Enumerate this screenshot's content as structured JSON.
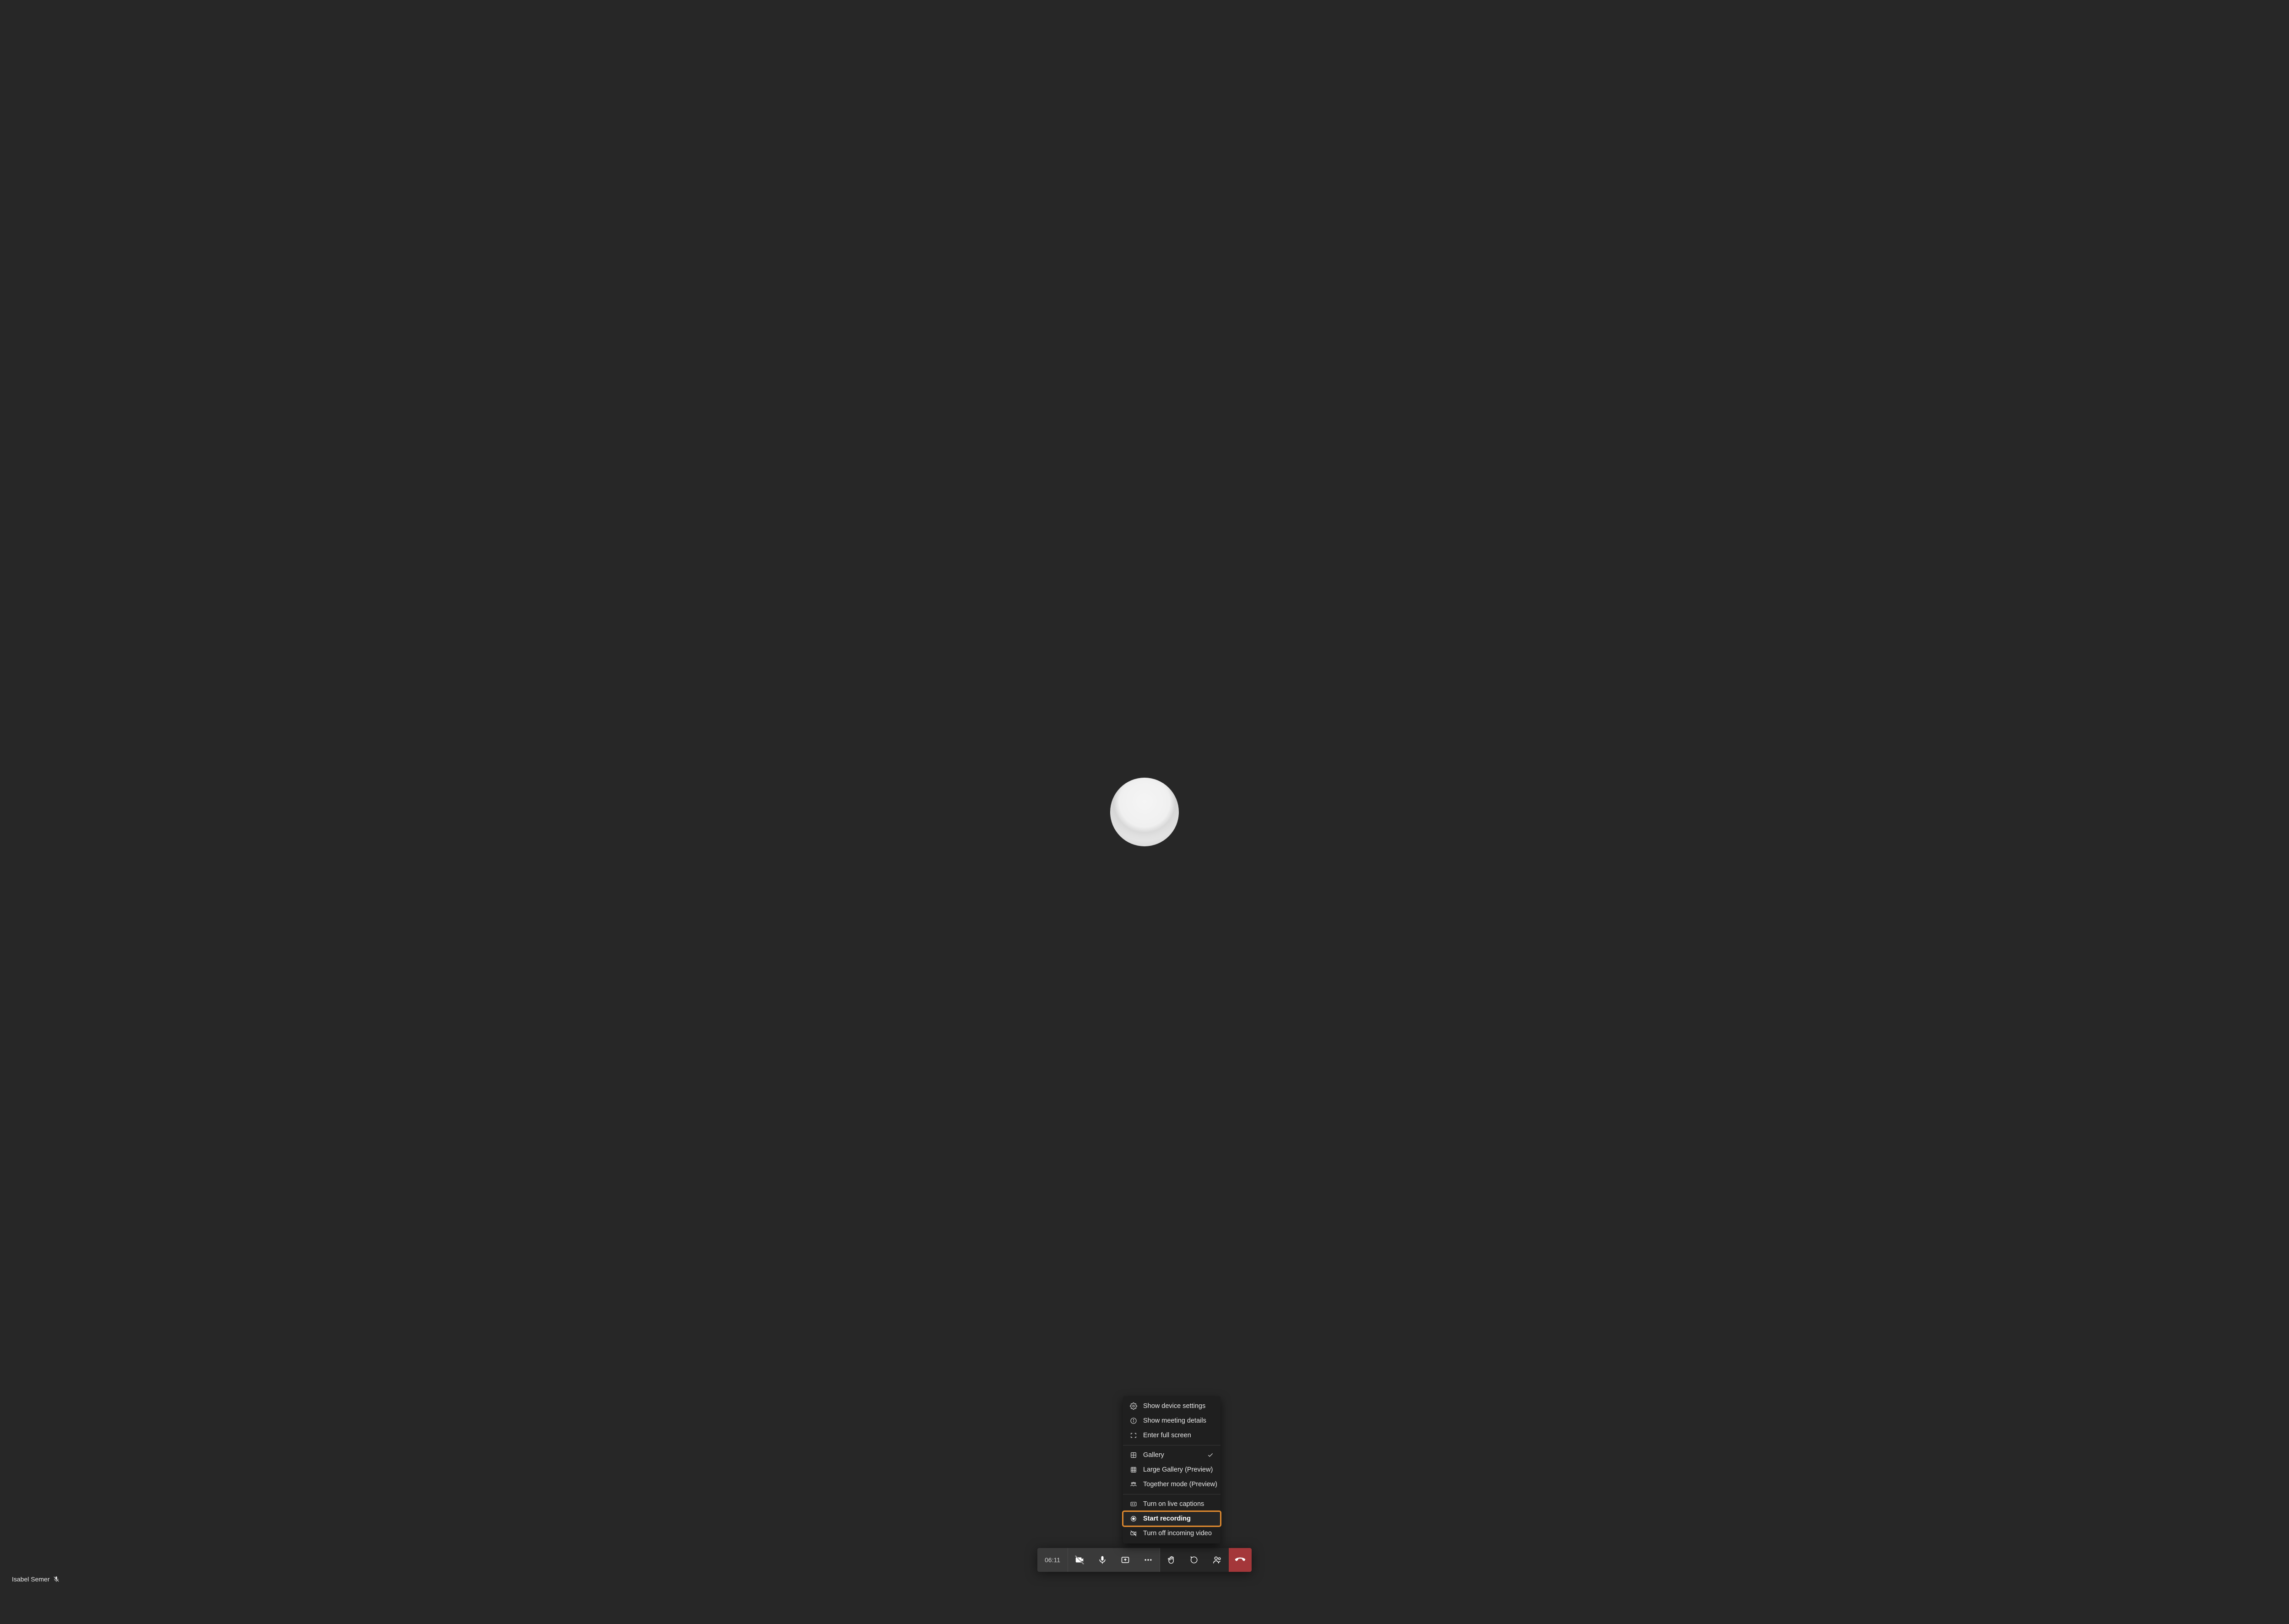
{
  "participant": {
    "name": "Isabel Semer",
    "muted": true
  },
  "timer": "06:11",
  "menu": {
    "device_settings": "Show device settings",
    "meeting_details": "Show meeting details",
    "full_screen": "Enter full screen",
    "gallery": "Gallery",
    "large_gallery": "Large Gallery (Preview)",
    "together_mode": "Together mode (Preview)",
    "live_captions": "Turn on live captions",
    "start_recording": "Start recording",
    "incoming_video_off": "Turn off incoming video",
    "gallery_selected": true
  },
  "toolbar": {
    "camera_off": true
  },
  "colors": {
    "highlight": "#e08a2f",
    "leave": "#a4373a"
  }
}
